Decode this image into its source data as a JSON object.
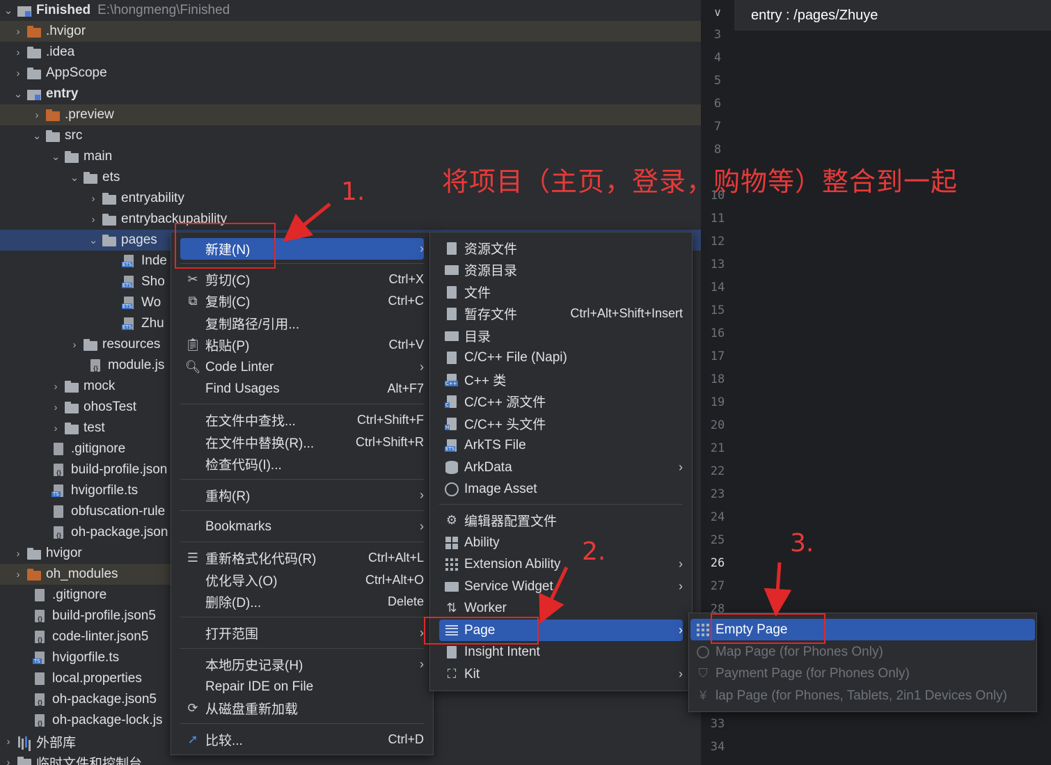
{
  "project_tree": {
    "root": {
      "name": "Finished",
      "path": "E:\\hongmeng\\Finished"
    },
    "items": [
      {
        "label": ".hvigor"
      },
      {
        "label": ".idea"
      },
      {
        "label": "AppScope"
      },
      {
        "label": "entry"
      },
      {
        "label": ".preview"
      },
      {
        "label": "src"
      },
      {
        "label": "main"
      },
      {
        "label": "ets"
      },
      {
        "label": "entryability"
      },
      {
        "label": "entrybackupability"
      },
      {
        "label": "pages"
      },
      {
        "label": "Inde"
      },
      {
        "label": "Sho"
      },
      {
        "label": "Wo"
      },
      {
        "label": "Zhu"
      },
      {
        "label": "resources"
      },
      {
        "label": "module.js"
      },
      {
        "label": "mock"
      },
      {
        "label": "ohosTest"
      },
      {
        "label": "test"
      },
      {
        "label": ".gitignore"
      },
      {
        "label": "build-profile.json"
      },
      {
        "label": "hvigorfile.ts"
      },
      {
        "label": "obfuscation-rule"
      },
      {
        "label": "oh-package.json"
      },
      {
        "label": "hvigor"
      },
      {
        "label": "oh_modules"
      },
      {
        "label": ".gitignore"
      },
      {
        "label": "build-profile.json5"
      },
      {
        "label": "code-linter.json5"
      },
      {
        "label": "hvigorfile.ts"
      },
      {
        "label": "local.properties"
      },
      {
        "label": "oh-package.json5"
      },
      {
        "label": "oh-package-lock.js"
      },
      {
        "label": "外部库"
      },
      {
        "label": "临时文件和控制台"
      }
    ]
  },
  "editor": {
    "tab_title": "entry : /pages/Zhuye",
    "dropdown_glyph": "∨",
    "line_numbers": [
      "3",
      "4",
      "5",
      "6",
      "7",
      "8",
      "10",
      "11",
      "12",
      "13",
      "14",
      "15",
      "16",
      "17",
      "18",
      "19",
      "20",
      "21",
      "22",
      "23",
      "24",
      "25",
      "26",
      "27",
      "28",
      "33",
      "34"
    ]
  },
  "context_menu": {
    "items": [
      {
        "label": "新建(N)",
        "shortcut": "",
        "arrow": "›"
      },
      {
        "label": "剪切(C)",
        "shortcut": "Ctrl+X"
      },
      {
        "label": "复制(C)",
        "shortcut": "Ctrl+C"
      },
      {
        "label": "复制路径/引用...",
        "shortcut": ""
      },
      {
        "label": "粘贴(P)",
        "shortcut": "Ctrl+V"
      },
      {
        "label": "Code Linter",
        "shortcut": "",
        "arrow": "›"
      },
      {
        "label": "Find Usages",
        "shortcut": "Alt+F7"
      },
      {
        "label": "在文件中查找...",
        "shortcut": "Ctrl+Shift+F"
      },
      {
        "label": "在文件中替换(R)...",
        "shortcut": "Ctrl+Shift+R"
      },
      {
        "label": "检查代码(I)...",
        "shortcut": ""
      },
      {
        "label": "重构(R)",
        "shortcut": "",
        "arrow": "›"
      },
      {
        "label": "Bookmarks",
        "shortcut": "",
        "arrow": "›"
      },
      {
        "label": "重新格式化代码(R)",
        "shortcut": "Ctrl+Alt+L"
      },
      {
        "label": "优化导入(O)",
        "shortcut": "Ctrl+Alt+O"
      },
      {
        "label": "删除(D)...",
        "shortcut": "Delete"
      },
      {
        "label": "打开范围",
        "shortcut": "",
        "arrow": "›"
      },
      {
        "label": "本地历史记录(H)",
        "shortcut": "",
        "arrow": "›"
      },
      {
        "label": "Repair IDE on File",
        "shortcut": ""
      },
      {
        "label": "从磁盘重新加载",
        "shortcut": ""
      },
      {
        "label": "比较...",
        "shortcut": "Ctrl+D"
      }
    ]
  },
  "new_submenu": {
    "items": [
      {
        "label": "资源文件",
        "shortcut": ""
      },
      {
        "label": "资源目录",
        "shortcut": ""
      },
      {
        "label": "文件",
        "shortcut": ""
      },
      {
        "label": "暂存文件",
        "shortcut": "Ctrl+Alt+Shift+Insert"
      },
      {
        "label": "目录",
        "shortcut": ""
      },
      {
        "label": "C/C++ File (Napi)",
        "shortcut": ""
      },
      {
        "label": "C++ 类",
        "shortcut": ""
      },
      {
        "label": "C/C++ 源文件",
        "shortcut": ""
      },
      {
        "label": "C/C++ 头文件",
        "shortcut": ""
      },
      {
        "label": "ArkTS File",
        "shortcut": ""
      },
      {
        "label": "ArkData",
        "shortcut": "",
        "arrow": "›"
      },
      {
        "label": "Image Asset",
        "shortcut": ""
      },
      {
        "label": "编辑器配置文件",
        "shortcut": ""
      },
      {
        "label": "Ability",
        "shortcut": ""
      },
      {
        "label": "Extension Ability",
        "shortcut": "",
        "arrow": "›"
      },
      {
        "label": "Service Widget",
        "shortcut": "",
        "arrow": "›"
      },
      {
        "label": "Worker",
        "shortcut": ""
      },
      {
        "label": "Page",
        "shortcut": "",
        "arrow": "›"
      },
      {
        "label": "Insight Intent",
        "shortcut": ""
      },
      {
        "label": "Kit",
        "shortcut": "",
        "arrow": "›"
      }
    ]
  },
  "page_submenu": {
    "items": [
      {
        "label": "Empty Page",
        "disabled": false
      },
      {
        "label": "Map Page (for Phones Only)",
        "disabled": true
      },
      {
        "label": "Payment Page (for Phones Only)",
        "disabled": true
      },
      {
        "label": "lap Page (for Phones, Tablets, 2in1 Devices Only)",
        "disabled": true
      }
    ]
  },
  "annotations": {
    "title": "将项目（主页，登录，购物等）整合到一起",
    "step1": "1.",
    "step2": "2.",
    "step3": "3.",
    "color": "#e02828"
  },
  "colors": {
    "selection": "#2e5ab0",
    "tree_selected": "#2e436e",
    "excluded_folder": "#c0662f"
  }
}
